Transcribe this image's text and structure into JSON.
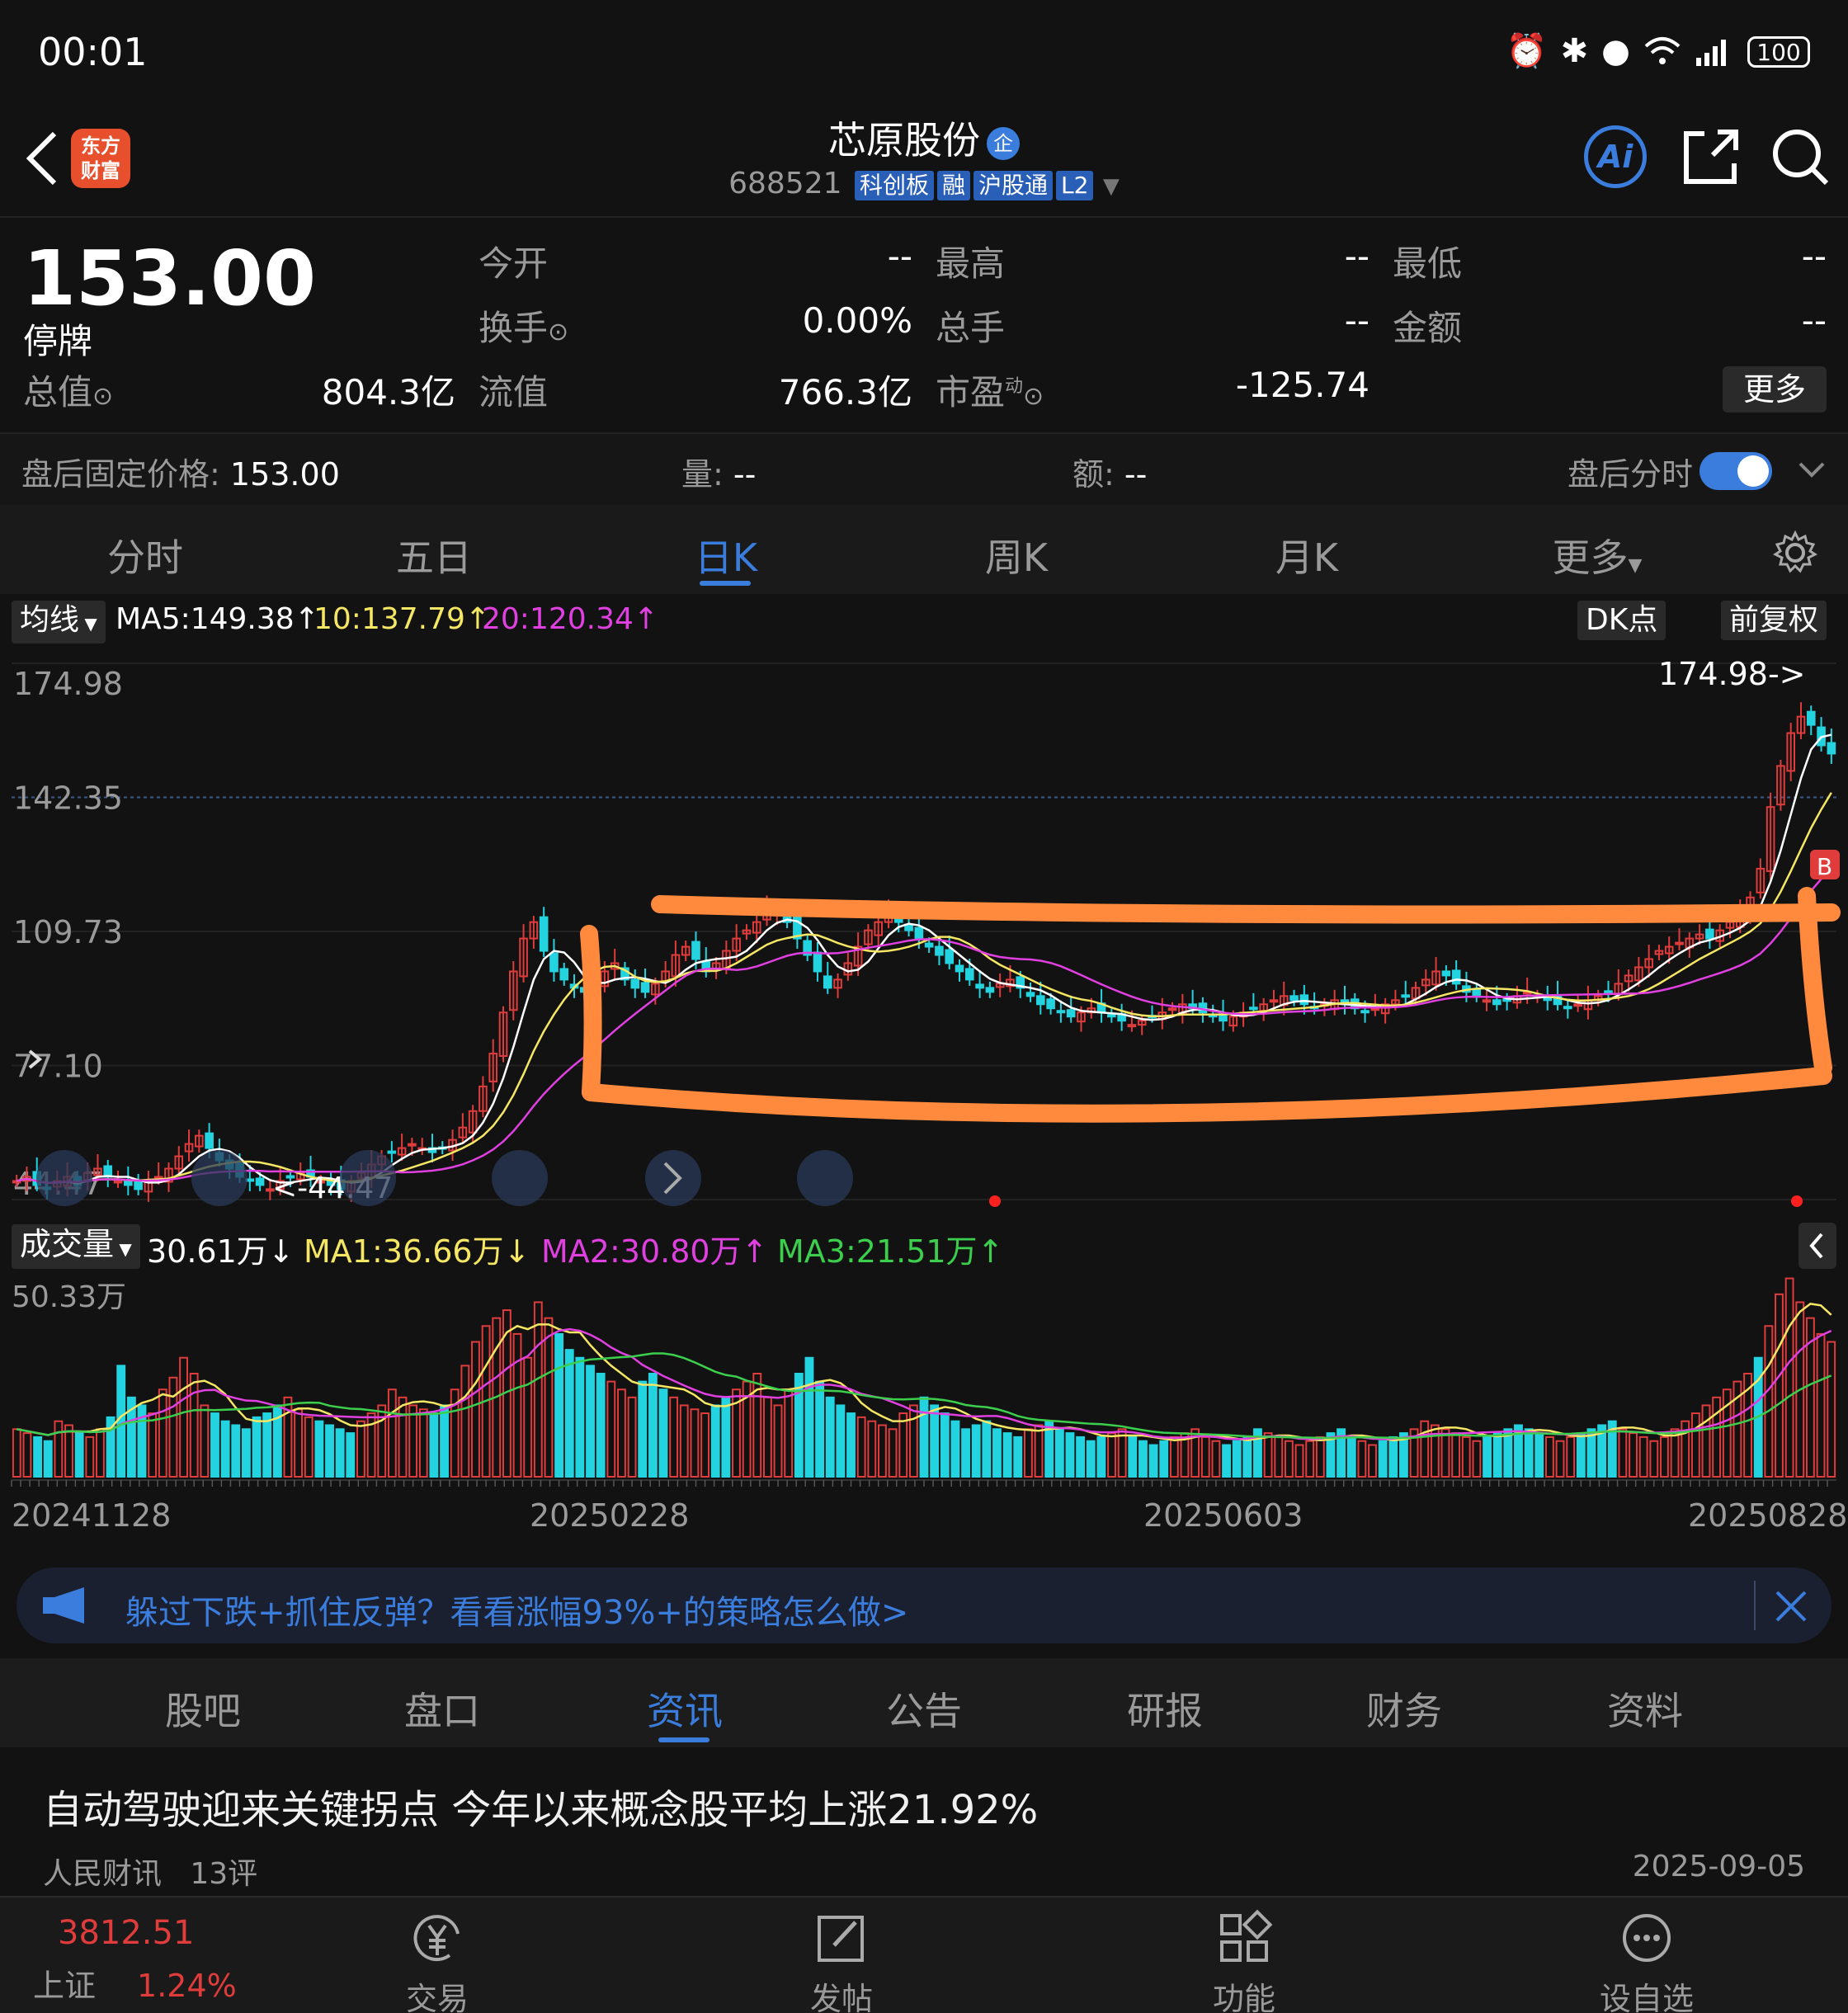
{
  "status": {
    "time": "00:01",
    "battery": "100"
  },
  "header": {
    "stock_name": "芯原股份",
    "qi_badge": "企",
    "code": "688521",
    "tags": [
      "科创板",
      "融",
      "沪股通",
      "L2"
    ],
    "logo_line1": "东方",
    "logo_line2": "财富",
    "ai_label": "Ai"
  },
  "quote": {
    "price": "153.00",
    "status": "停牌",
    "open_label": "今开",
    "open": "--",
    "high_label": "最高",
    "high": "--",
    "low_label": "最低",
    "low": "--",
    "turnover_label": "换手",
    "turnover": "0.00%",
    "total_hands_label": "总手",
    "total_hands": "--",
    "amount_label": "金额",
    "amount": "--",
    "mkt_cap_label": "总值",
    "mkt_cap": "804.3亿",
    "float_cap_label": "流值",
    "float_cap": "766.3亿",
    "pe_label": "市盈",
    "pe_sup": "动",
    "pe": "-125.74",
    "more": "更多"
  },
  "afterhours": {
    "fixed_price_label": "盘后固定价格:",
    "fixed_price": "153.00",
    "vol_label": "量:",
    "vol": "--",
    "amt_label": "额:",
    "amt": "--",
    "toggle_label": "盘后分时"
  },
  "period_tabs": [
    "分时",
    "五日",
    "日K",
    "周K",
    "月K",
    "更多"
  ],
  "ma_bar": {
    "selector": "均线",
    "ma5": "MA5:149.38",
    "ma10": "10:137.79",
    "ma20": "20:120.34",
    "dk": "DK点",
    "adjust": "前复权"
  },
  "colors": {
    "ma5": "#ffffff",
    "ma10": "#f5e663",
    "ma20": "#e040e0",
    "up": "#e03c3c",
    "down": "#23d4e0",
    "accent": "#3b7ddd",
    "highlight": "#ff8a3d",
    "vma3": "#3ccf4e"
  },
  "chart_data": [
    {
      "type": "candlestick",
      "y_ticks": [
        "174.98",
        "142.35",
        "109.73",
        "77.10",
        "44.47"
      ],
      "ylim": [
        44.47,
        174.98
      ],
      "max_label": "174.98->",
      "min_label": "<-44.47",
      "x_ticks": [
        "20241128",
        "20250228",
        "20250603",
        "20250828"
      ],
      "series": [
        {
          "name": "MA5",
          "values": [
            149.38
          ]
        },
        {
          "name": "MA10",
          "values": [
            137.79
          ]
        },
        {
          "name": "MA20",
          "values": [
            120.34
          ]
        }
      ],
      "closes": [
        49,
        50,
        48,
        47,
        49,
        50,
        48,
        51,
        52,
        50,
        49,
        48,
        47,
        49,
        50,
        52,
        55,
        58,
        60,
        57,
        54,
        52,
        50,
        49,
        48,
        47,
        49,
        50,
        51,
        50,
        49,
        48,
        47,
        49,
        51,
        53,
        55,
        56,
        57,
        58,
        57,
        56,
        57,
        59,
        62,
        66,
        72,
        80,
        90,
        100,
        108,
        112,
        105,
        100,
        98,
        96,
        95,
        97,
        100,
        102,
        98,
        96,
        95,
        97,
        100,
        104,
        106,
        103,
        100,
        102,
        105,
        108,
        110,
        112,
        115,
        114,
        112,
        108,
        104,
        100,
        96,
        98,
        102,
        106,
        110,
        112,
        114,
        112,
        110,
        108,
        106,
        104,
        102,
        100,
        98,
        96,
        95,
        97,
        98,
        96,
        94,
        92,
        91,
        90,
        89,
        90,
        91,
        90,
        89,
        88,
        87,
        88,
        89,
        90,
        91,
        92,
        91,
        90,
        89,
        88,
        89,
        90,
        91,
        92,
        93,
        94,
        93,
        92,
        91,
        92,
        93,
        92,
        91,
        90,
        91,
        92,
        93,
        94,
        96,
        98,
        100,
        99,
        97,
        95,
        94,
        93,
        92,
        93,
        94,
        95,
        94,
        93,
        92,
        91,
        92,
        93,
        94,
        95,
        97,
        99,
        101,
        103,
        105,
        106,
        107,
        108,
        109,
        108,
        110,
        112,
        114,
        118,
        125,
        140,
        150,
        158,
        162,
        160,
        155,
        153
      ]
    },
    {
      "type": "bar",
      "y_ticks": [
        "50.33万"
      ],
      "ylim": [
        0,
        50.33
      ],
      "title": "成交量",
      "vol": "30.61万",
      "ma1": "MA1:36.66万",
      "ma2": "MA2:30.80万",
      "ma3": "MA3:21.51万",
      "values": [
        12,
        11,
        10,
        9,
        14,
        13,
        11,
        10,
        12,
        15,
        28,
        20,
        18,
        16,
        22,
        25,
        30,
        26,
        18,
        16,
        14,
        13,
        12,
        15,
        16,
        18,
        20,
        17,
        15,
        14,
        13,
        12,
        11,
        14,
        16,
        18,
        22,
        20,
        18,
        17,
        16,
        18,
        22,
        28,
        34,
        38,
        40,
        42,
        36,
        30,
        44,
        40,
        36,
        32,
        30,
        28,
        26,
        24,
        22,
        20,
        24,
        26,
        22,
        20,
        18,
        17,
        16,
        18,
        20,
        22,
        24,
        26,
        20,
        18,
        22,
        26,
        30,
        24,
        20,
        18,
        16,
        15,
        14,
        13,
        12,
        16,
        18,
        20,
        18,
        16,
        14,
        12,
        13,
        14,
        12,
        11,
        10,
        12,
        13,
        14,
        12,
        11,
        10,
        9,
        10,
        11,
        12,
        10,
        9,
        8,
        9,
        10,
        11,
        12,
        10,
        9,
        8,
        9,
        10,
        12,
        11,
        10,
        9,
        8,
        9,
        10,
        11,
        12,
        10,
        9,
        8,
        9,
        10,
        11,
        12,
        14,
        13,
        12,
        11,
        10,
        9,
        10,
        11,
        12,
        13,
        12,
        11,
        10,
        9,
        10,
        11,
        12,
        13,
        14,
        12,
        11,
        10,
        9,
        10,
        12,
        14,
        16,
        18,
        20,
        22,
        24,
        26,
        30,
        38,
        46,
        50,
        44,
        40,
        36,
        34
      ]
    }
  ],
  "banner": {
    "text": "躲过下跌+抓住反弹？看看涨幅93%+的策略怎么做>"
  },
  "info_tabs": [
    "股吧",
    "盘口",
    "资讯",
    "公告",
    "研报",
    "财务",
    "资料"
  ],
  "news": {
    "title": "自动驾驶迎来关键拐点 今年以来概念股平均上涨21.92%",
    "source": "人民财讯",
    "comments": "13评",
    "date": "2025-09-05"
  },
  "bottom": {
    "index_value": "3812.51",
    "index_name": "上证",
    "index_change": "1.24%",
    "nav": [
      "交易",
      "发帖",
      "功能",
      "设自选"
    ]
  }
}
